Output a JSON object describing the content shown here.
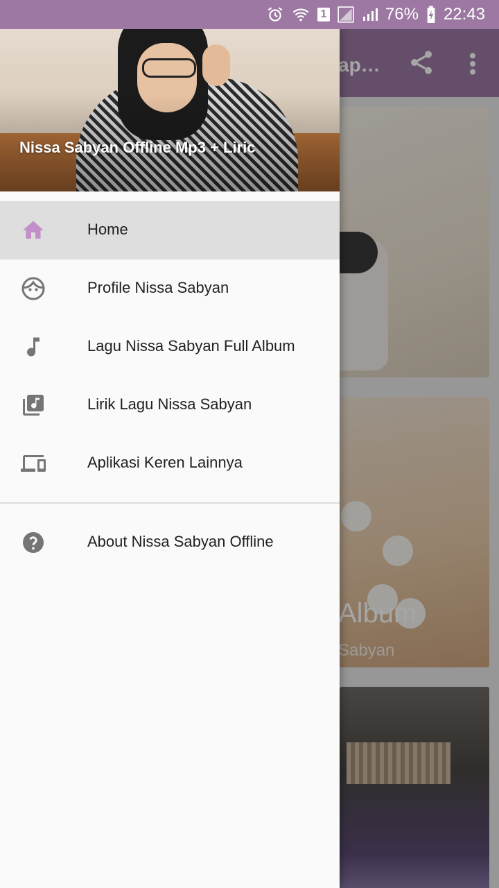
{
  "status_bar": {
    "battery": "76%",
    "time": "22:43",
    "sim_badge": "1"
  },
  "app": {
    "toolbar_title": "ap…",
    "card2_title": "Album",
    "card2_subtitle": "Sabyan"
  },
  "drawer": {
    "header_title": "Nissa Sabyan Offline Mp3 + Liric",
    "items": [
      {
        "label": "Home",
        "icon": "home-icon",
        "active": true
      },
      {
        "label": "Profile Nissa Sabyan",
        "icon": "face-icon"
      },
      {
        "label": "Lagu Nissa Sabyan Full Album",
        "icon": "music-note-icon"
      },
      {
        "label": "Lirik Lagu Nissa Sabyan",
        "icon": "library-music-icon"
      },
      {
        "label": "Aplikasi Keren Lainnya",
        "icon": "devices-icon"
      }
    ],
    "about_label": "About Nissa Sabyan Offline"
  },
  "colors": {
    "primary": "#9c78a2",
    "active_icon": "#c38fc8",
    "icon_gray": "#757575"
  }
}
